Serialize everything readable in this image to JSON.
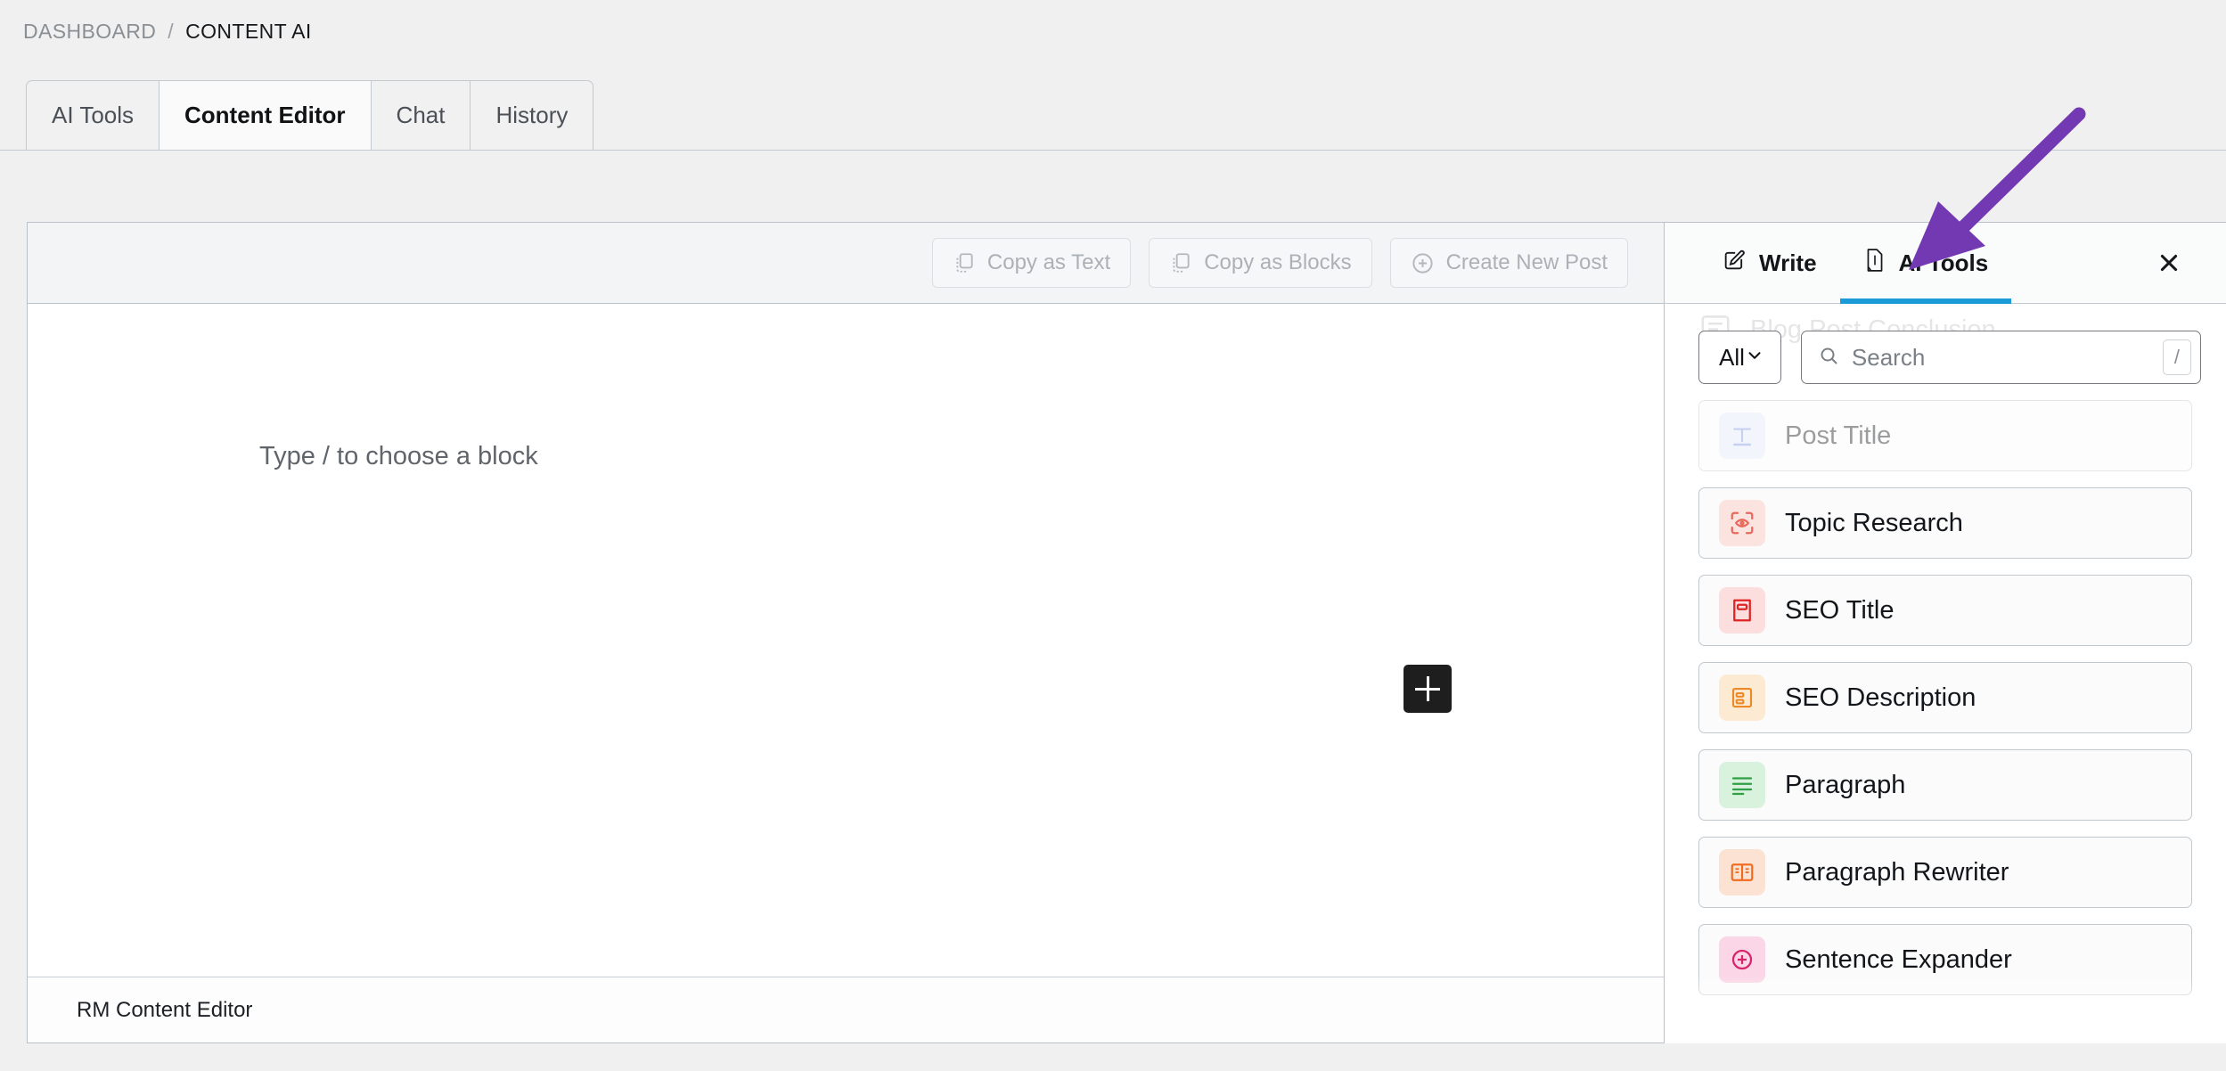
{
  "breadcrumb": {
    "root": "DASHBOARD",
    "separator": "/",
    "current": "CONTENT AI"
  },
  "tabs": [
    {
      "label": "AI Tools",
      "active": false
    },
    {
      "label": "Content Editor",
      "active": true
    },
    {
      "label": "Chat",
      "active": false
    },
    {
      "label": "History",
      "active": false
    }
  ],
  "editor": {
    "toolbar": {
      "copy_as_text": "Copy as Text",
      "copy_as_blocks": "Copy as Blocks",
      "create_new_post": "Create New Post"
    },
    "block_placeholder": "Type / to choose a block",
    "add_block_icon": "plus-icon",
    "status_bar": "RM Content Editor"
  },
  "ai_panel": {
    "tabs": [
      {
        "label": "Write",
        "icon": "pencil-square-icon",
        "active": false
      },
      {
        "label": "AI Tools",
        "icon": "document-ai-icon",
        "active": true
      }
    ],
    "close_icon": "close-icon",
    "accent_color": "#1a9bd7",
    "filter": {
      "selected": "All",
      "chevron": "chevron-down-icon"
    },
    "search": {
      "placeholder": "Search",
      "value": "",
      "icon": "search-icon",
      "shortcut": "/"
    },
    "ghost_item": {
      "label": "Blog Post Conclusion"
    },
    "tools": [
      {
        "label": "Post Title",
        "icon": "title-icon",
        "icon_color": "#7a93e0",
        "icon_bg": "#e4e9fb",
        "faded": true
      },
      {
        "label": "Topic Research",
        "icon": "scan-eye-icon",
        "icon_color": "#e8695c",
        "icon_bg": "#fbe3e0",
        "faded": false
      },
      {
        "label": "SEO Title",
        "icon": "seo-title-icon",
        "icon_color": "#e02424",
        "icon_bg": "#fbdedd",
        "faded": false
      },
      {
        "label": "SEO Description",
        "icon": "seo-desc-icon",
        "icon_color": "#eb8a26",
        "icon_bg": "#fcead3",
        "faded": false
      },
      {
        "label": "Paragraph",
        "icon": "lines-icon",
        "icon_color": "#2f9e44",
        "icon_bg": "#d9f2de",
        "faded": false
      },
      {
        "label": "Paragraph Rewriter",
        "icon": "book-open-icon",
        "icon_color": "#f06a1e",
        "icon_bg": "#fce2d2",
        "faded": false
      },
      {
        "label": "Sentence Expander",
        "icon": "circle-pink-icon",
        "icon_color": "#d6246d",
        "icon_bg": "#fbd6e6",
        "faded": false
      }
    ]
  },
  "annotation": {
    "type": "arrow",
    "color": "#7239b3",
    "points_to": "AI Tools"
  }
}
